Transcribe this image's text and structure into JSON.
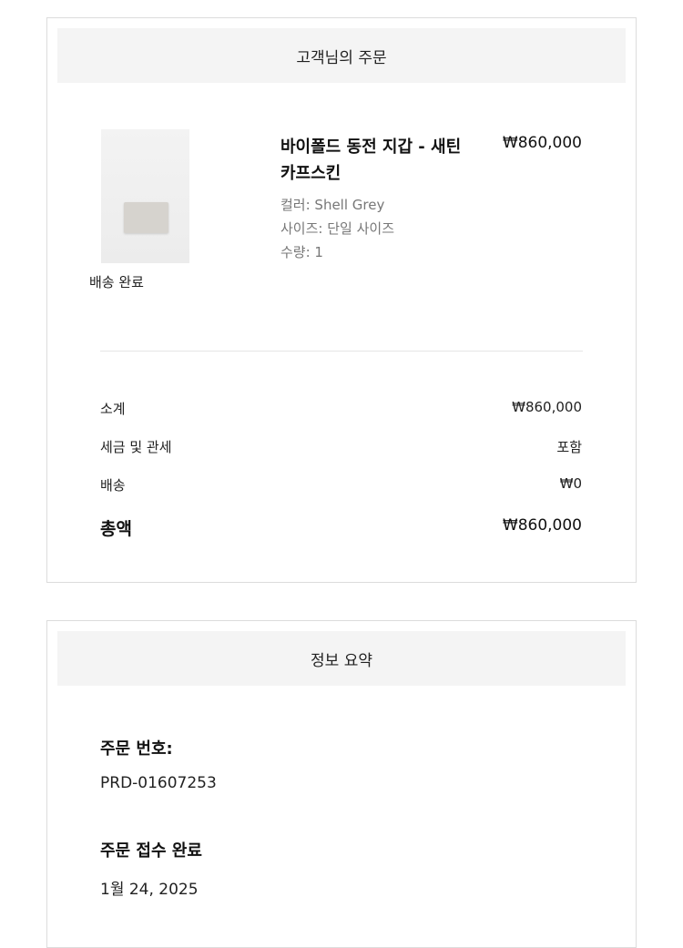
{
  "order": {
    "header": "고객님의 주문",
    "item": {
      "name": "바이폴드 동전 지갑 - 새틴 카프스킨",
      "price": "₩860,000",
      "color": "컬러: Shell Grey",
      "size": "사이즈: 단일 사이즈",
      "quantity": "수량: 1",
      "status": "배송 완료",
      "image_icon": "wallet-product-image"
    },
    "summary": {
      "subtotal_label": "소계",
      "subtotal_value": "₩860,000",
      "tax_label": "세금 및 관세",
      "tax_value": "포함",
      "shipping_label": "배송",
      "shipping_value": "₩0",
      "total_label": "총액",
      "total_value": "₩860,000"
    }
  },
  "info": {
    "header": "정보 요약",
    "order_number_label": "주문 번호:",
    "order_number_value": "PRD-01607253",
    "order_date_label": "주문 접수 완료",
    "order_date_value": "1월 24, 2025"
  },
  "colors": {
    "header_bg": "#f4f4f4",
    "border": "#dcdcdc",
    "muted_text": "#777777"
  }
}
